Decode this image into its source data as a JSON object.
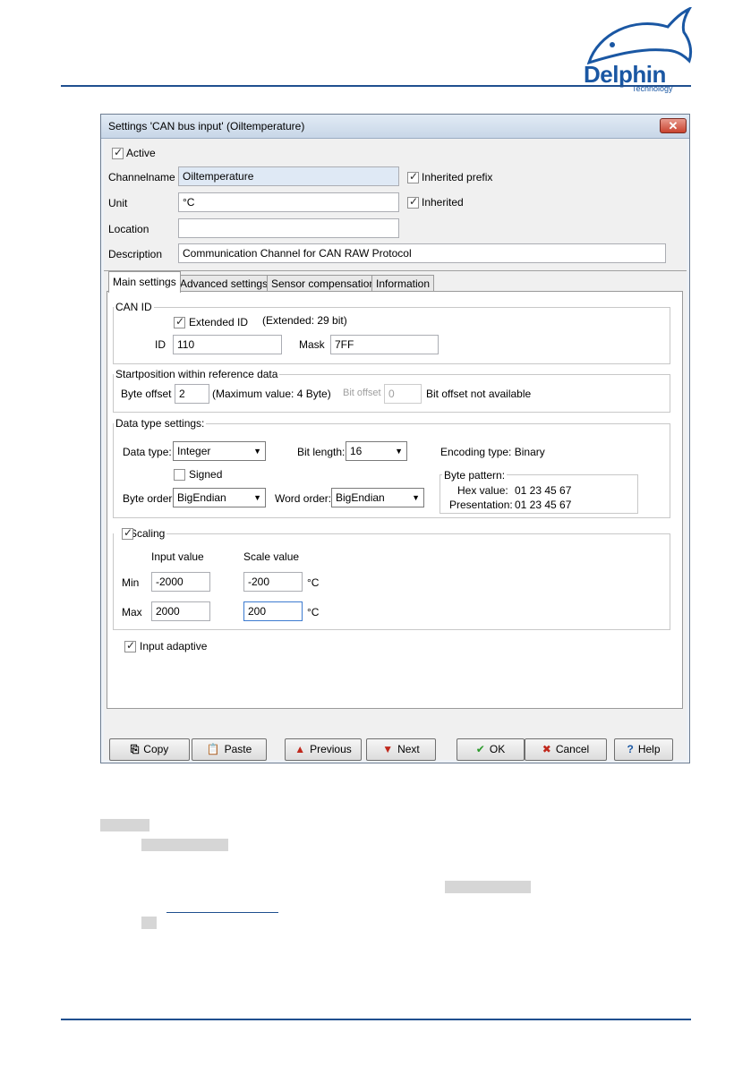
{
  "branding": {
    "logo_name": "Delphin",
    "logo_sub": "Technology"
  },
  "dialog": {
    "title": "Settings 'CAN bus input' (Oiltemperature)",
    "close_glyph": "✕",
    "active": {
      "label": "Active",
      "checked": true
    },
    "channelname": {
      "label": "Channelname",
      "value": "Oiltemperature"
    },
    "inherited_prefix": {
      "label": "Inherited prefix",
      "checked": true
    },
    "unit": {
      "label": "Unit",
      "value": "°C"
    },
    "inherited": {
      "label": "Inherited",
      "checked": true
    },
    "location": {
      "label": "Location",
      "value": ""
    },
    "description": {
      "label": "Description",
      "value": "Communication Channel for CAN RAW Protocol"
    },
    "tabs": [
      "Main settings",
      "Advanced settings",
      "Sensor compensation",
      "Information"
    ],
    "can_id": {
      "title": "CAN ID",
      "extended_label": "Extended ID",
      "extended_checked": true,
      "extended_note": "(Extended: 29 bit)",
      "id_label": "ID",
      "id_value": "110",
      "mask_label": "Mask",
      "mask_value": "7FF"
    },
    "startposition": {
      "title": "Startposition within reference data",
      "byte_offset_label": "Byte offset",
      "byte_offset_value": "2",
      "byte_offset_note": "(Maximum value: 4 Byte)",
      "bit_offset_label": "Bit offset",
      "bit_offset_value": "0",
      "bit_offset_note": "Bit offset not available"
    },
    "data_type": {
      "title": "Data type settings:",
      "data_type_label": "Data type:",
      "data_type_value": "Integer",
      "bit_length_label": "Bit length:",
      "bit_length_value": "16",
      "encoding": "Encoding type: Binary",
      "signed_label": "Signed",
      "signed_checked": false,
      "byte_order_label": "Byte order:",
      "byte_order_value": "BigEndian",
      "word_order_label": "Word order:",
      "word_order_value": "BigEndian",
      "byte_pattern": {
        "title": "Byte pattern:",
        "hex_label": "Hex value:",
        "hex_value": "01 23 45 67",
        "pres_label": "Presentation:",
        "pres_value": "01 23 45 67"
      }
    },
    "scaling": {
      "title": "Scaling",
      "checked": true,
      "input_header": "Input value",
      "scale_header": "Scale value",
      "min_label": "Min",
      "min_input": "-2000",
      "min_scale": "-200",
      "max_label": "Max",
      "max_input": "2000",
      "max_scale": "200",
      "unit": "°C"
    },
    "input_adaptive": {
      "label": "Input adaptive",
      "checked": true
    },
    "buttons": {
      "copy": "Copy",
      "paste": "Paste",
      "previous": "Previous",
      "next": "Next",
      "ok": "OK",
      "cancel": "Cancel",
      "help": "Help"
    }
  },
  "colors": {
    "brand": "#1a57a3",
    "rule": "#1f4f8f"
  }
}
